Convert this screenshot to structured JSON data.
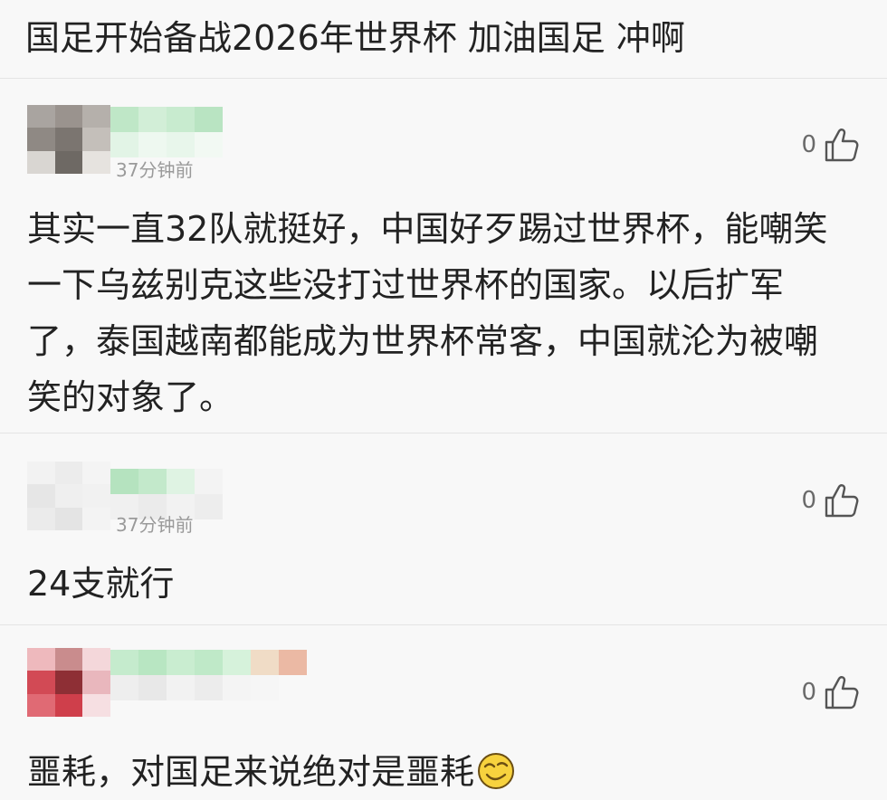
{
  "post": {
    "title": "国足开始备战2026年世界杯 加油国足 冲啊"
  },
  "comments": [
    {
      "time": "37分钟前",
      "likes": "0",
      "text": "其实一直32队就挺好，中国好歹踢过世界杯，能嘲笑一下乌兹别克这些没打过世界杯的国家。以后扩军了，泰国越南都能成为世界杯常客，中国就沦为被嘲笑的对象了。",
      "icons": {
        "like": "thumbs-up-icon"
      }
    },
    {
      "time": "37分钟前",
      "likes": "0",
      "text": "24支就行",
      "icons": {
        "like": "thumbs-up-icon"
      }
    },
    {
      "time": "",
      "likes": "0",
      "text": "噩耗，对国足来说绝对是噩耗",
      "icons": {
        "like": "thumbs-up-icon",
        "emoji": "smirk-face-icon"
      }
    }
  ],
  "colors": {
    "background": "#f8f8f8",
    "text": "#222222",
    "muted": "#9a9a9a",
    "divider": "#e4e4e4"
  }
}
